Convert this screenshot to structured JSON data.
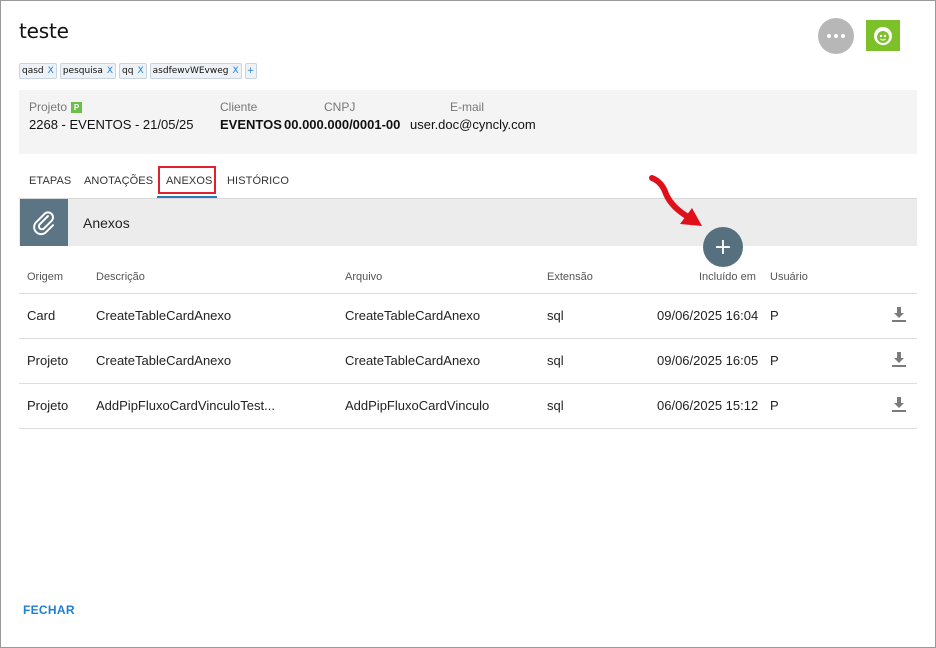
{
  "header": {
    "title": "teste"
  },
  "tags": [
    {
      "label": "qasd",
      "remove": "X"
    },
    {
      "label": "pesquisa",
      "remove": "X"
    },
    {
      "label": "qq",
      "remove": "X"
    },
    {
      "label": "asdfewvWEvweg",
      "remove": "X"
    }
  ],
  "tag_add": "+",
  "info": {
    "projeto_label": "Projeto",
    "projeto_badge": "P",
    "projeto_value": "2268 - EVENTOS - 21/05/25",
    "cliente_label": "Cliente",
    "cliente_value": "EVENTOS",
    "cnpj_label": "CNPJ",
    "cnpj_value": "00.000.000/0001-00",
    "email_label": "E-mail",
    "email_value": "user.doc@cyncly.com"
  },
  "tabs": [
    "ETAPAS",
    "ANOTAÇÕES",
    "ANEXOS",
    "HISTÓRICO"
  ],
  "active_tab": "ANEXOS",
  "section": {
    "title": "Anexos",
    "add_label": "+"
  },
  "table": {
    "columns": [
      "Origem",
      "Descrição",
      "Arquivo",
      "Extensão",
      "Incluído em",
      "Usuário"
    ],
    "rows": [
      [
        "Card",
        "CreateTableCardAnexo",
        "CreateTableCardAnexo",
        "sql",
        "09/06/2025 16:04",
        "P"
      ],
      [
        "Projeto",
        "CreateTableCardAnexo",
        "CreateTableCardAnexo",
        "sql",
        "09/06/2025 16:05",
        "P"
      ],
      [
        "Projeto",
        "AddPipFluxoCardVinculoTest...",
        "AddPipFluxoCardVinculo",
        "sql",
        "06/06/2025 15:12",
        "P"
      ]
    ]
  },
  "footer": {
    "close_label": "FECHAR"
  },
  "colors": {
    "accent": "#1e7fd3",
    "section_icon_bg": "#5b7585",
    "avatar_bg": "#7cc12a",
    "highlight": "#e0202a"
  }
}
